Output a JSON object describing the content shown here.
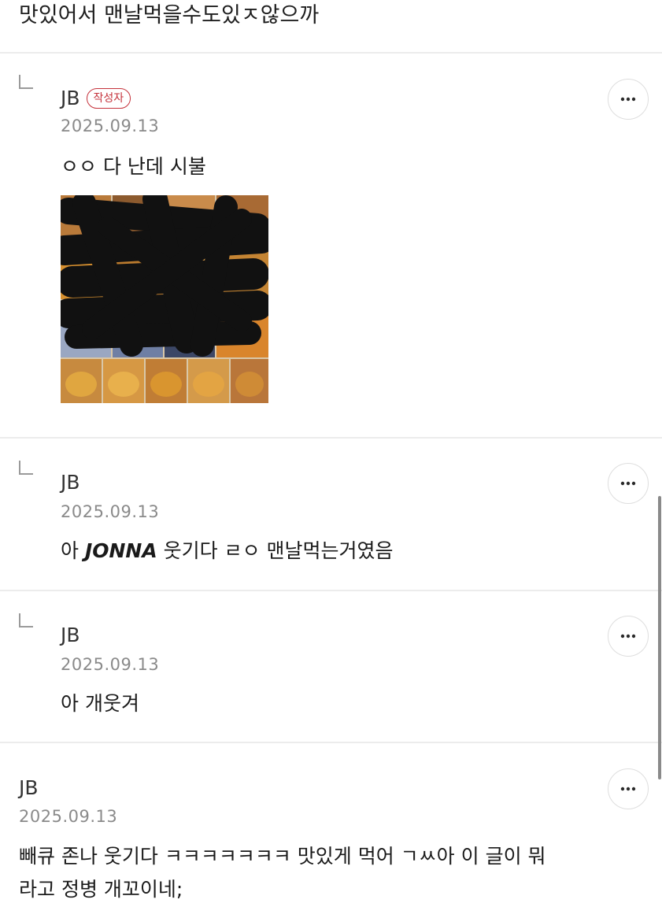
{
  "post_tail": {
    "text": "맛있어서 맨날먹을수도있ㅈ않으까"
  },
  "comments": [
    {
      "author": "JB",
      "badge": "작성자",
      "date": "2025.09.13",
      "text": "ㅇㅇ 다 난데 시불",
      "has_image": true,
      "is_reply": true
    },
    {
      "author": "JB",
      "date": "2025.09.13",
      "text_before": "아 ",
      "text_emphasis": "JONNA",
      "text_after": " 웃기다 ㄹㅇ 맨날먹는거였음",
      "is_reply": true
    },
    {
      "author": "JB",
      "date": "2025.09.13",
      "text": "아 개웃겨",
      "is_reply": true
    },
    {
      "author": "JB",
      "date": "2025.09.13",
      "text_line1": "빼큐 존나 웃기다 ㅋㅋㅋㅋㅋㅋㅋ 맛있게 먹어 ㄱㅆ아 이 글이 뭐",
      "text_line2": "라고 정병 개꼬이네;",
      "is_reply": false
    }
  ],
  "icons": {
    "more": "more-horizontal-icon",
    "reply": "reply-arrow-icon"
  },
  "colors": {
    "badge": "#c5323b",
    "date": "#8a8a8a",
    "divider": "#ececec"
  }
}
